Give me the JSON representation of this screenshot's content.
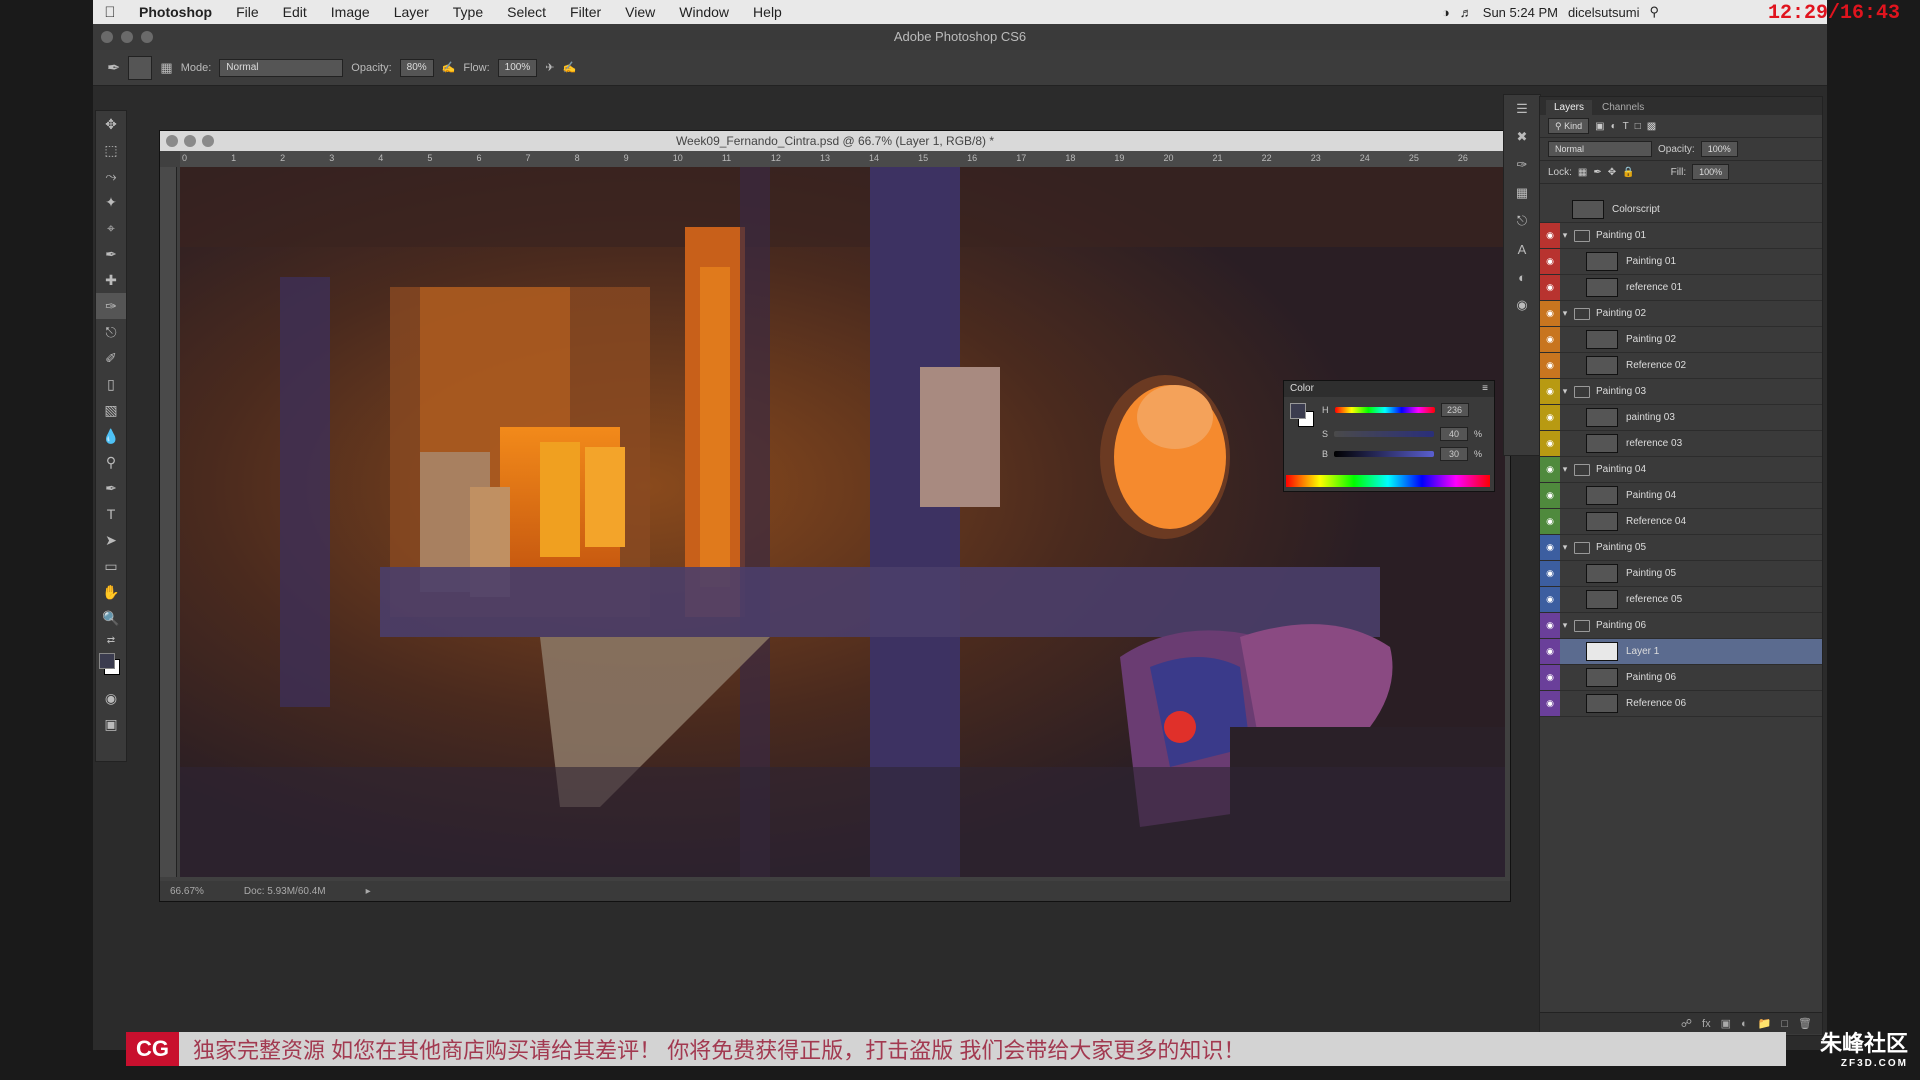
{
  "menubar": {
    "app": "Photoshop",
    "items": [
      "File",
      "Edit",
      "Image",
      "Layer",
      "Type",
      "Select",
      "Filter",
      "View",
      "Window",
      "Help"
    ],
    "status": "Sun 5:24 PM",
    "user": "dicelsutsumi",
    "clock_overlay": "12:29/16:43"
  },
  "window": {
    "title": "Adobe Photoshop CS6"
  },
  "options": {
    "mode_label": "Mode:",
    "mode_value": "Normal",
    "opacity_label": "Opacity:",
    "opacity_value": "80%",
    "flow_label": "Flow:",
    "flow_value": "100%"
  },
  "document": {
    "title": "Week09_Fernando_Cintra.psd @ 66.7% (Layer 1, RGB/8) *",
    "zoom": "66.67%",
    "doc_size": "Doc: 5.93M/60.4M",
    "ruler_ticks": [
      "0",
      "1",
      "2",
      "3",
      "4",
      "5",
      "6",
      "7",
      "8",
      "9",
      "10",
      "11",
      "12",
      "13",
      "14",
      "15",
      "16",
      "17",
      "18",
      "19",
      "20",
      "21",
      "22",
      "23",
      "24",
      "25",
      "26"
    ]
  },
  "color_panel": {
    "title": "Color",
    "h_label": "H",
    "h_value": "236",
    "s_label": "S",
    "s_value": "40",
    "b_label": "B",
    "b_value": "30",
    "unit": "%"
  },
  "layers_panel": {
    "tabs": [
      "Layers",
      "Channels"
    ],
    "kind_label": "Kind",
    "blend_mode": "Normal",
    "opacity_label": "Opacity:",
    "opacity_value": "100%",
    "lock_label": "Lock:",
    "fill_label": "Fill:",
    "fill_value": "100%",
    "layers": [
      {
        "name": "Colorscript",
        "type": "layer",
        "color": "#3a3a3a",
        "selected": false
      },
      {
        "name": "Painting 01",
        "type": "group",
        "color": "#b8332f",
        "selected": false
      },
      {
        "name": "Painting 01",
        "type": "layer",
        "color": "#b8332f",
        "selected": false
      },
      {
        "name": "reference 01",
        "type": "layer",
        "color": "#b8332f",
        "selected": false
      },
      {
        "name": "Painting 02",
        "type": "group",
        "color": "#c8751f",
        "selected": false
      },
      {
        "name": "Painting 02",
        "type": "layer",
        "color": "#c8751f",
        "selected": false
      },
      {
        "name": "Reference 02",
        "type": "layer",
        "color": "#c8751f",
        "selected": false
      },
      {
        "name": "Painting 03",
        "type": "group",
        "color": "#b89a12",
        "selected": false
      },
      {
        "name": "painting 03",
        "type": "layer",
        "color": "#b89a12",
        "selected": false
      },
      {
        "name": "reference 03",
        "type": "layer",
        "color": "#b89a12",
        "selected": false
      },
      {
        "name": "Painting 04",
        "type": "group",
        "color": "#4f8a3d",
        "selected": false
      },
      {
        "name": "Painting 04",
        "type": "layer",
        "color": "#4f8a3d",
        "selected": false
      },
      {
        "name": "Reference 04",
        "type": "layer",
        "color": "#4f8a3d",
        "selected": false
      },
      {
        "name": "Painting 05",
        "type": "group",
        "color": "#3c5ea0",
        "selected": false
      },
      {
        "name": "Painting 05",
        "type": "layer",
        "color": "#3c5ea0",
        "selected": false
      },
      {
        "name": "reference 05",
        "type": "layer",
        "color": "#3c5ea0",
        "selected": false
      },
      {
        "name": "Painting 06",
        "type": "group",
        "color": "#6a3f9a",
        "selected": false
      },
      {
        "name": "Layer 1",
        "type": "layer",
        "color": "#6a3f9a",
        "selected": true
      },
      {
        "name": "Painting 06",
        "type": "layer",
        "color": "#6a3f9a",
        "selected": false
      },
      {
        "name": "Reference 06",
        "type": "layer",
        "color": "#6a3f9a",
        "selected": false
      }
    ]
  },
  "banner": {
    "logo": "CG",
    "text": "独家完整资源 如您在其他商店购买请给其差评！ 你将免费获得正版，打击盗版 我们会带给大家更多的知识！"
  },
  "watermark": {
    "name": "朱峰社区",
    "site": "ZF3D.COM"
  },
  "colors": {
    "accent": "#5b6b8f",
    "panel": "#3a3a3a",
    "banner_red": "#c8102e"
  }
}
